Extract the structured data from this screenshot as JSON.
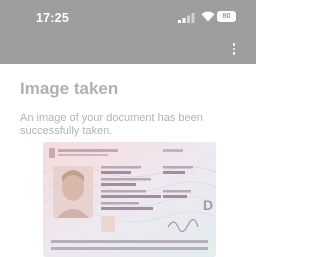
{
  "status_bar": {
    "time": "17:25",
    "battery": "80",
    "icons": [
      "signal-icon",
      "wifi-icon",
      "battery-icon"
    ]
  },
  "app_bar": {
    "menu_icon": "more-vert-icon"
  },
  "content": {
    "title": "Image taken",
    "message": "An image of your document has been successfully taken.",
    "document_image": {
      "description_icon": "passport-image",
      "letter": "D"
    }
  },
  "colors": {
    "bar": "#9e9e9e",
    "title": "#b0b0b0",
    "text": "#b3b3b3"
  }
}
